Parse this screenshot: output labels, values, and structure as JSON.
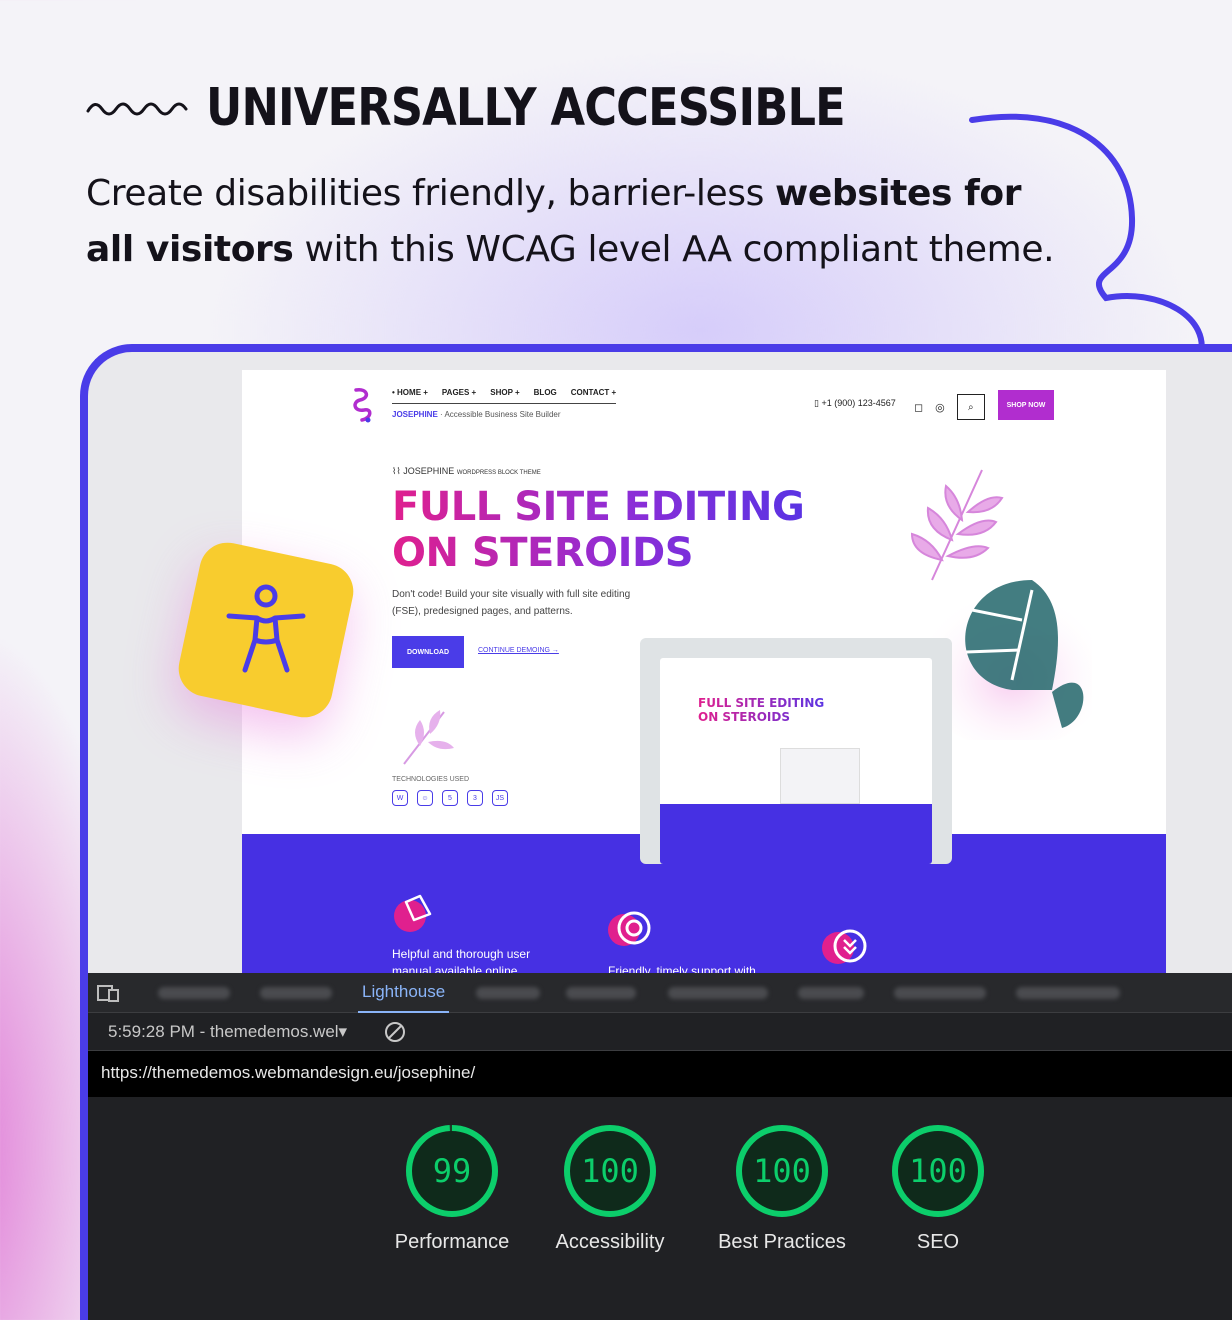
{
  "headline": "UNIVERSALLY ACCESSIBLE",
  "subtitle": {
    "part1": "Create disabilities friendly, barrier-less ",
    "bold1": "websites for",
    "bold2": "all visitors",
    "part2": " with this WCAG level AA compliant theme."
  },
  "site": {
    "nav": [
      "• HOME +",
      "PAGES +",
      "SHOP +",
      "BLOG",
      "CONTACT +"
    ],
    "brand_name": "JOSEPHINE",
    "brand_tagline": "Accessible Business Site Builder",
    "phone": "+1 (900) 123-4567",
    "shop_button": "SHOP NOW",
    "eyebrow": "JOSEPHINE",
    "eyebrow_small": "WORDPRESS BLOCK THEME",
    "hero_line1": "FULL SITE EDITING",
    "hero_line2": "ON STEROIDS",
    "hero_desc": "Don't code! Build your site visually with full site editing (FSE), predesigned pages, and patterns.",
    "download_button": "DOWNLOAD",
    "demo_link": "CONTINUE DEMOING →",
    "tech_label": "TECHNOLOGIES USED",
    "tech_icons": [
      "W",
      "☺",
      "5",
      "3",
      "JS"
    ],
    "features": [
      "Helpful and thorough user manual available online",
      "Friendly, timely support with",
      ""
    ],
    "mini_title_1": "FULL SITE EDITING",
    "mini_title_2": "ON STEROIDS"
  },
  "devtools": {
    "active_tab": "Lighthouse",
    "report_label": "5:59:28 PM - themedemos.wel▾",
    "url": "https://themedemos.webmandesign.eu/josephine/",
    "scores": [
      {
        "value": "99",
        "label": "Performance",
        "fraction": 0.99
      },
      {
        "value": "100",
        "label": "Accessibility",
        "fraction": 1.0
      },
      {
        "value": "100",
        "label": "Best Practices",
        "fraction": 1.0
      },
      {
        "value": "100",
        "label": "SEO",
        "fraction": 1.0
      }
    ],
    "score_color": "#0cce6b"
  },
  "colors": {
    "accent": "#4a3ce8",
    "badge": "#f8cc2e",
    "magenta": "#e0208e"
  }
}
